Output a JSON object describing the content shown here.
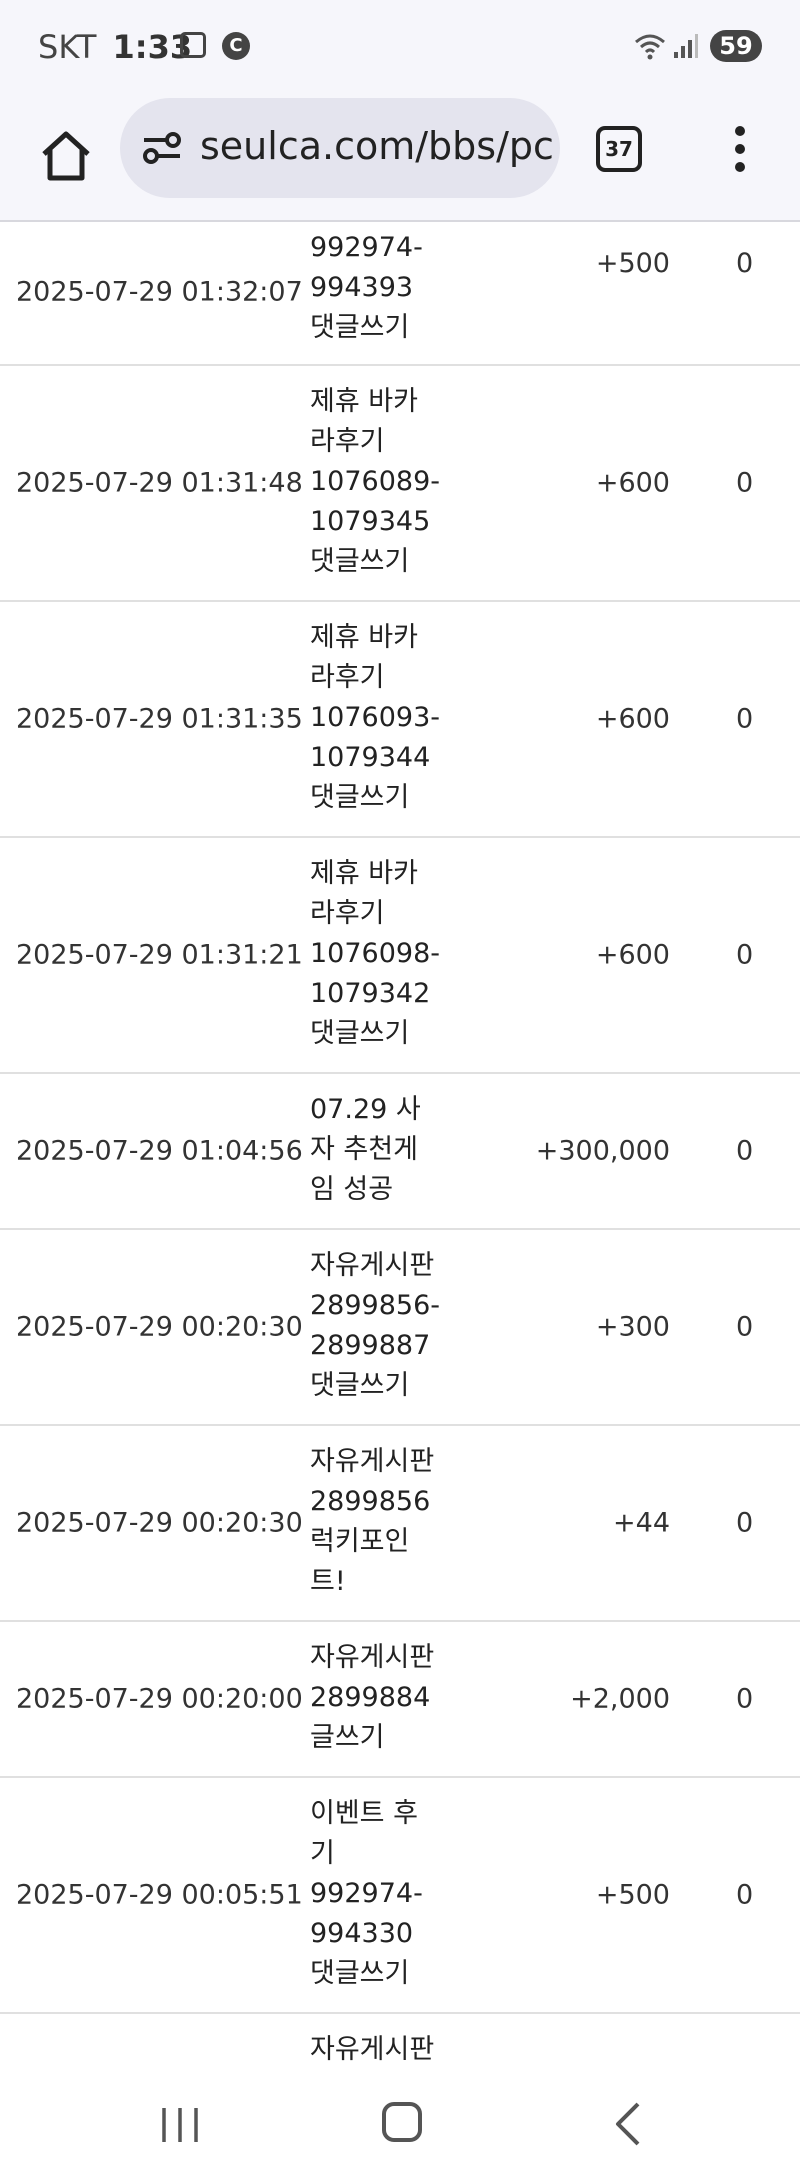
{
  "status_bar": {
    "carrier": "SKT",
    "time": "1:33",
    "c_badge": "C",
    "battery": "59",
    "icons": [
      "screenshot-icon",
      "c-badge-icon",
      "wifi-icon",
      "signal-icon",
      "battery-icon"
    ]
  },
  "browser": {
    "url": "seulca.com/bbs/pc",
    "tab_count": "37",
    "icons": [
      "home-icon",
      "site-settings-icon",
      "tabs-icon",
      "more-menu-icon"
    ]
  },
  "rows": [
    {
      "date": "2025-07-29 01:32:07",
      "desc": [
        "992974-",
        "994393",
        "댓글쓰기"
      ],
      "amount": "+500",
      "balance": "0"
    },
    {
      "date": "2025-07-29 01:31:48",
      "desc": [
        "제휴 바카",
        "라후기",
        "1076089-",
        "1079345",
        "댓글쓰기"
      ],
      "amount": "+600",
      "balance": "0"
    },
    {
      "date": "2025-07-29 01:31:35",
      "desc": [
        "제휴 바카",
        "라후기",
        "1076093-",
        "1079344",
        "댓글쓰기"
      ],
      "amount": "+600",
      "balance": "0"
    },
    {
      "date": "2025-07-29 01:31:21",
      "desc": [
        "제휴 바카",
        "라후기",
        "1076098-",
        "1079342",
        "댓글쓰기"
      ],
      "amount": "+600",
      "balance": "0"
    },
    {
      "date": "2025-07-29 01:04:56",
      "desc": [
        "07.29 사",
        "자 추천게",
        "임 성공"
      ],
      "amount": "+300,000",
      "balance": "0"
    },
    {
      "date": "2025-07-29 00:20:30",
      "desc": [
        "자유게시판",
        "2899856-",
        "2899887",
        "댓글쓰기"
      ],
      "amount": "+300",
      "balance": "0"
    },
    {
      "date": "2025-07-29 00:20:30",
      "desc": [
        "자유게시판",
        "2899856",
        "럭키포인",
        "트!"
      ],
      "amount": "+44",
      "balance": "0"
    },
    {
      "date": "2025-07-29 00:20:00",
      "desc": [
        "자유게시판",
        "2899884",
        "글쓰기"
      ],
      "amount": "+2,000",
      "balance": "0"
    },
    {
      "date": "2025-07-29 00:05:51",
      "desc": [
        "이벤트 후",
        "기",
        "992974-",
        "994330",
        "댓글쓰기"
      ],
      "amount": "+500",
      "balance": "0"
    },
    {
      "date": "",
      "desc": [
        "자유게시판"
      ],
      "amount": "",
      "balance": ""
    }
  ],
  "nav": {
    "icons": [
      "recent-apps-icon",
      "home-button-icon",
      "back-icon"
    ]
  }
}
